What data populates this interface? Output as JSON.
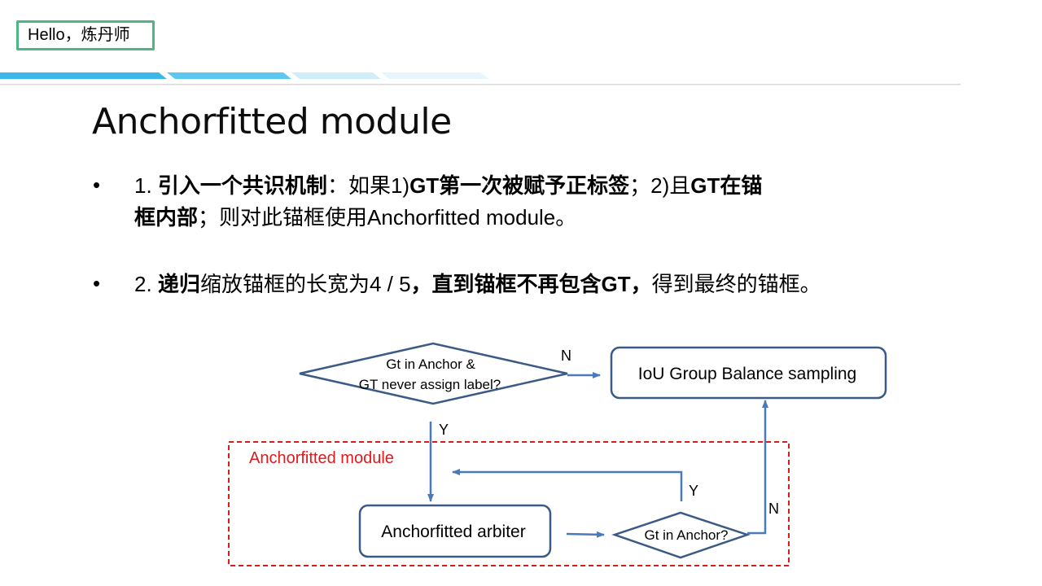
{
  "badge": {
    "text": "Hello，炼丹师"
  },
  "title": "Anchorfitted module",
  "bullets": [
    {
      "marker": "•",
      "line1": {
        "a": "1. ",
        "b": "引入一个共识机制",
        "c": "：如果1)",
        "d": "GT第一次被赋予正标签",
        "e": "；2)且",
        "f": "GT在锚"
      },
      "line2": {
        "a": "框内部",
        "b": "；则对此锚框使用Anchorfitted module。"
      }
    },
    {
      "marker": "•",
      "line1": {
        "a": "2. ",
        "b": "递归",
        "c": "缩放锚框的长宽为4 / 5",
        "d": "，直到锚框不再包含GT，",
        "e": "得到最终的锚框。"
      }
    }
  ],
  "diagram": {
    "decision1": {
      "line1": "Gt in Anchor  &",
      "line2": "GT never assign label?"
    },
    "iou_box": "IoU Group Balance sampling",
    "group_label": "Anchorfitted module",
    "arbiter_box": "Anchorfitted arbiter",
    "decision2": "Gt in Anchor?",
    "labels": {
      "n_top": "N",
      "y_top": "Y",
      "y_right": "Y",
      "n_right": "N"
    },
    "colors": {
      "shape": "#3b5a85",
      "arrow": "#4a7ab8",
      "group": "#e0191b",
      "badge_border": "#4cb783"
    }
  }
}
